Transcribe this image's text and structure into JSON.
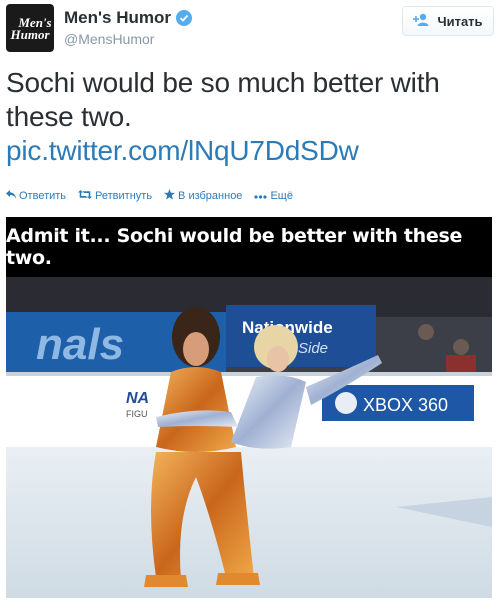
{
  "tweet": {
    "display_name": "Men's Humor",
    "handle": "@MensHumor",
    "avatar_text_1": "Men's",
    "avatar_text_2": "Humor",
    "follow_label": "Читать",
    "text": "Sochi would be so much better with these two.",
    "link": "pic.twitter.com/lNqU7DdSDw"
  },
  "actions": {
    "reply": "Ответить",
    "retweet": "Ретвитнуть",
    "favorite": "В избранное",
    "more": "Ещё"
  },
  "media": {
    "caption": "Admit it... Sochi would be better with these two.",
    "sign_nationwide": "Nationwide",
    "sign_side": "Side",
    "sign_xbox": "XBOX 360",
    "sign_nals": "nals",
    "sign_na": "NA",
    "sign_figu": "FIGU"
  },
  "colors": {
    "link": "#2b7bb9",
    "text": "#292f33",
    "muted": "#8899a6",
    "verified": "#55acee"
  }
}
